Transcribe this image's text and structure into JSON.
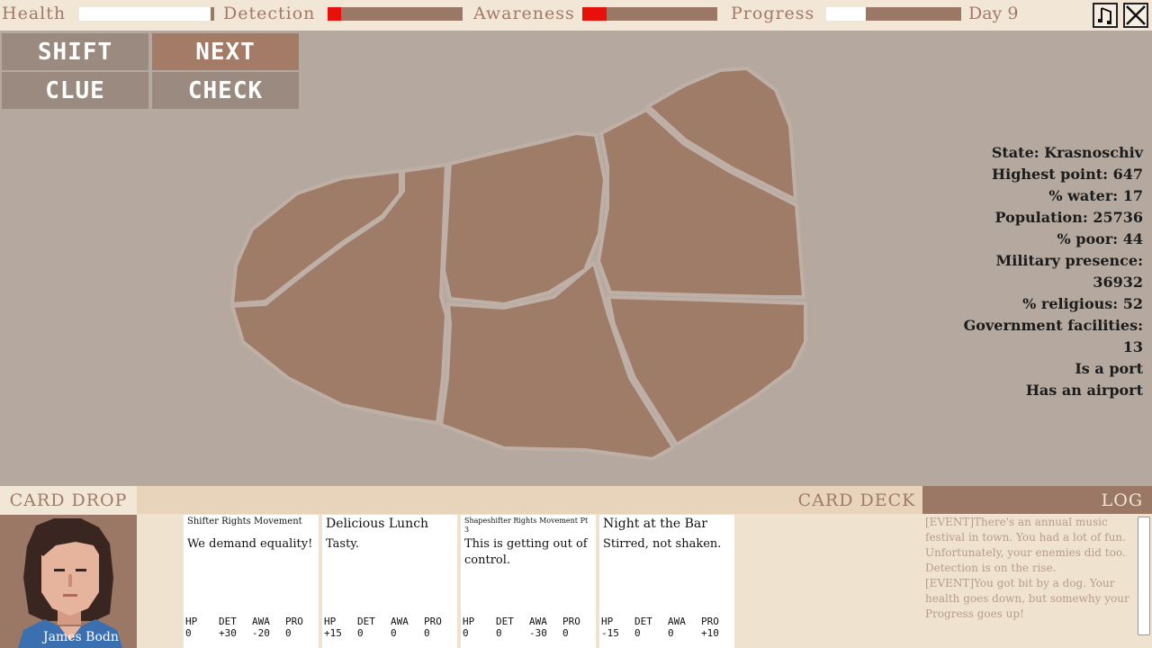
{
  "topbar": {
    "health": {
      "label": "Health",
      "fraction": 0.97
    },
    "detection": {
      "label": "Detection",
      "fraction": 0.1,
      "color": "#e8100a"
    },
    "awareness": {
      "label": "Awareness",
      "fraction": 0.18,
      "color": "#e8100a"
    },
    "progress": {
      "label": "Progress",
      "fraction": 0.29
    },
    "day": "Day 9",
    "music_icon": "music-note-icon",
    "close_icon": "close-icon"
  },
  "actions": {
    "shift": "SHIFT",
    "next": "NEXT",
    "clue": "CLUE",
    "check": "CHECK"
  },
  "info": {
    "state": "State: Krasnoschiv",
    "highest_point": "Highest point: 647",
    "water": "% water: 17",
    "population": "Population: 25736",
    "poor": "% poor: 44",
    "military_label": "Military presence:",
    "military_value": "36932",
    "religious": "% religious: 52",
    "gov_label": "Government facilities:",
    "gov_value": "13",
    "port": "Is a port",
    "airport": "Has an airport"
  },
  "bottom": {
    "card_drop": "CARD DROP",
    "card_deck": "CARD DECK",
    "log": "LOG",
    "portrait_name": "James Bodn"
  },
  "cards": [
    {
      "title": "Shifter Rights Movement",
      "text": "We demand equality!",
      "hp": "0",
      "det": "+30",
      "awa": "-20",
      "pro": "0"
    },
    {
      "title": "Delicious Lunch",
      "text": "Tasty.",
      "hp": "+15",
      "det": "0",
      "awa": "0",
      "pro": "0"
    },
    {
      "title": "Shapeshifter Rights Movement Pt 3",
      "text": "This is getting out of control.",
      "hp": "0",
      "det": "0",
      "awa": "-30",
      "pro": "0"
    },
    {
      "title": "Night at the Bar",
      "text": "Stirred, not shaken.",
      "hp": "-15",
      "det": "0",
      "awa": "0",
      "pro": "+10"
    }
  ],
  "stat_labels": {
    "hp": "HP",
    "det": "DET",
    "awa": "AWA",
    "pro": "PRO"
  },
  "log_entries": [
    "[EVENT]There's an annual music festival in town. You had a lot of fun. Unfortunately, your enemies did too. Detection is on the rise.",
    "[EVENT]You got bit by a dog. Your health goes down, but somewhy your Progress goes up!"
  ],
  "colors": {
    "map_bg": "#b5a89f",
    "region": "#9f7c68",
    "region_border": "#bfb0a7",
    "accent": "#9b7866",
    "panel": "#efe2cf"
  }
}
